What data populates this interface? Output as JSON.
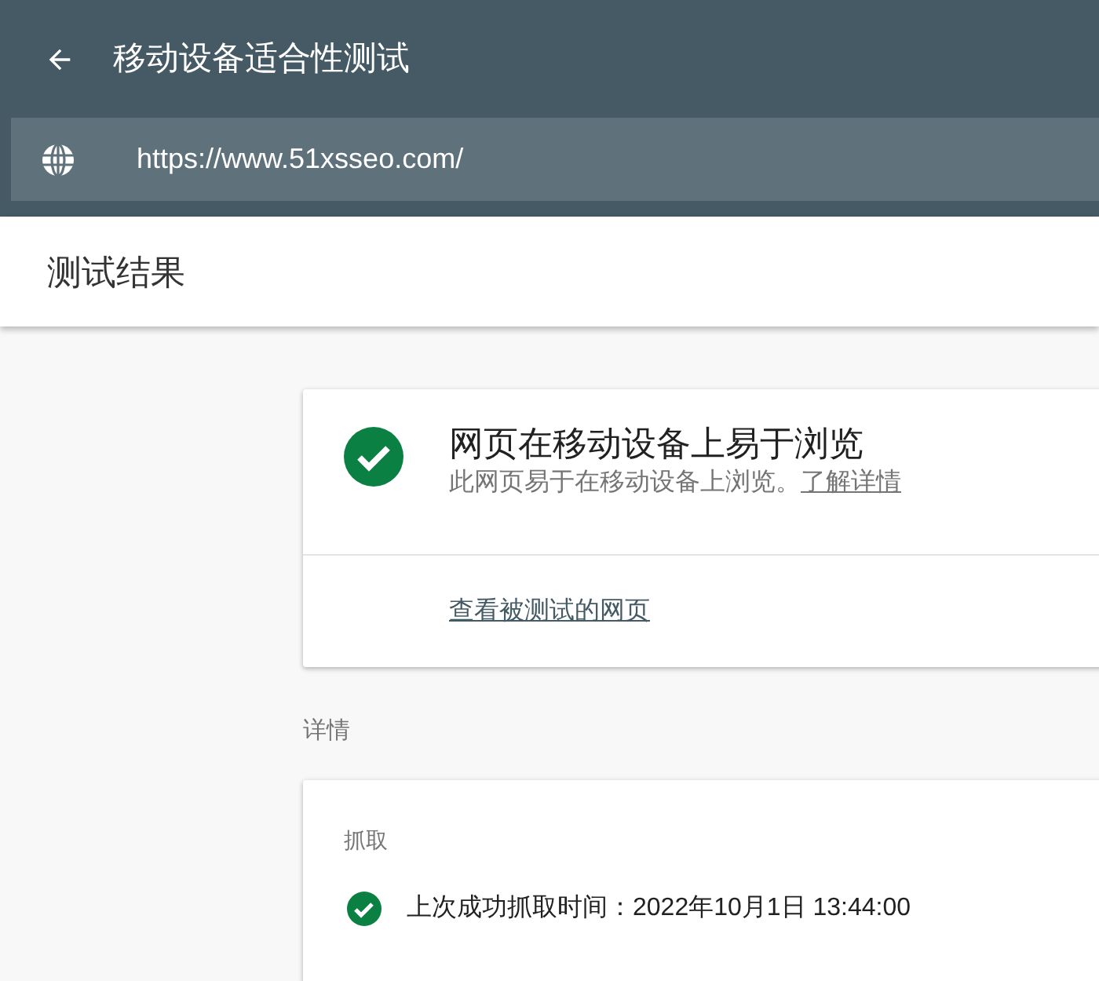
{
  "header": {
    "title": "移动设备适合性测试",
    "url": "https://www.51xsseo.com/"
  },
  "results_bar": {
    "title": "测试结果"
  },
  "result_card": {
    "headline": "网页在移动设备上易于浏览",
    "description": "此网页易于在移动设备上浏览。",
    "link": "了解详情",
    "action": "查看被测试的网页"
  },
  "details": {
    "heading": "详情",
    "section": "抓取",
    "items": [
      {
        "text": "上次成功抓取时间：2022年10月1日 13:44:00"
      }
    ]
  }
}
